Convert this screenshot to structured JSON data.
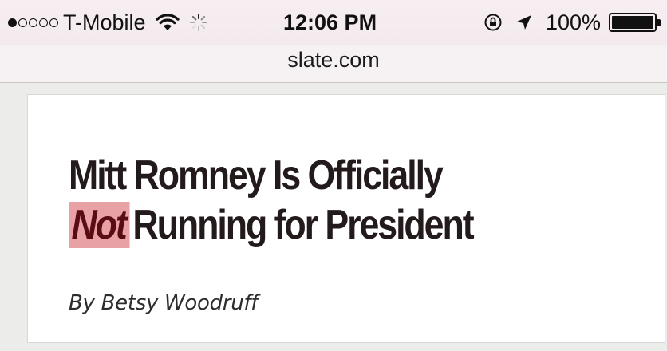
{
  "status_bar": {
    "carrier": "T-Mobile",
    "signal_bars_filled": 1,
    "signal_bars_total": 5,
    "time": "12:06 PM",
    "battery_percent": "100%",
    "battery_level": 1.0,
    "icons": [
      "signal-dots-icon",
      "wifi-icon",
      "activity-spinner-icon",
      "orientation-lock-icon",
      "location-arrow-icon",
      "battery-icon"
    ]
  },
  "url_bar": {
    "url": "slate.com"
  },
  "article": {
    "headline_line1": "Mitt Romney Is Officially",
    "headline_emphasis": "Not",
    "headline_line2_rest": "Running for President",
    "byline": "By Betsy Woodruff"
  },
  "colors": {
    "status_bar_bg": "#f5ecf0",
    "headline_text": "#231a1c",
    "highlight_bg": "#e8a2a6",
    "highlight_text": "#5a0c14"
  }
}
